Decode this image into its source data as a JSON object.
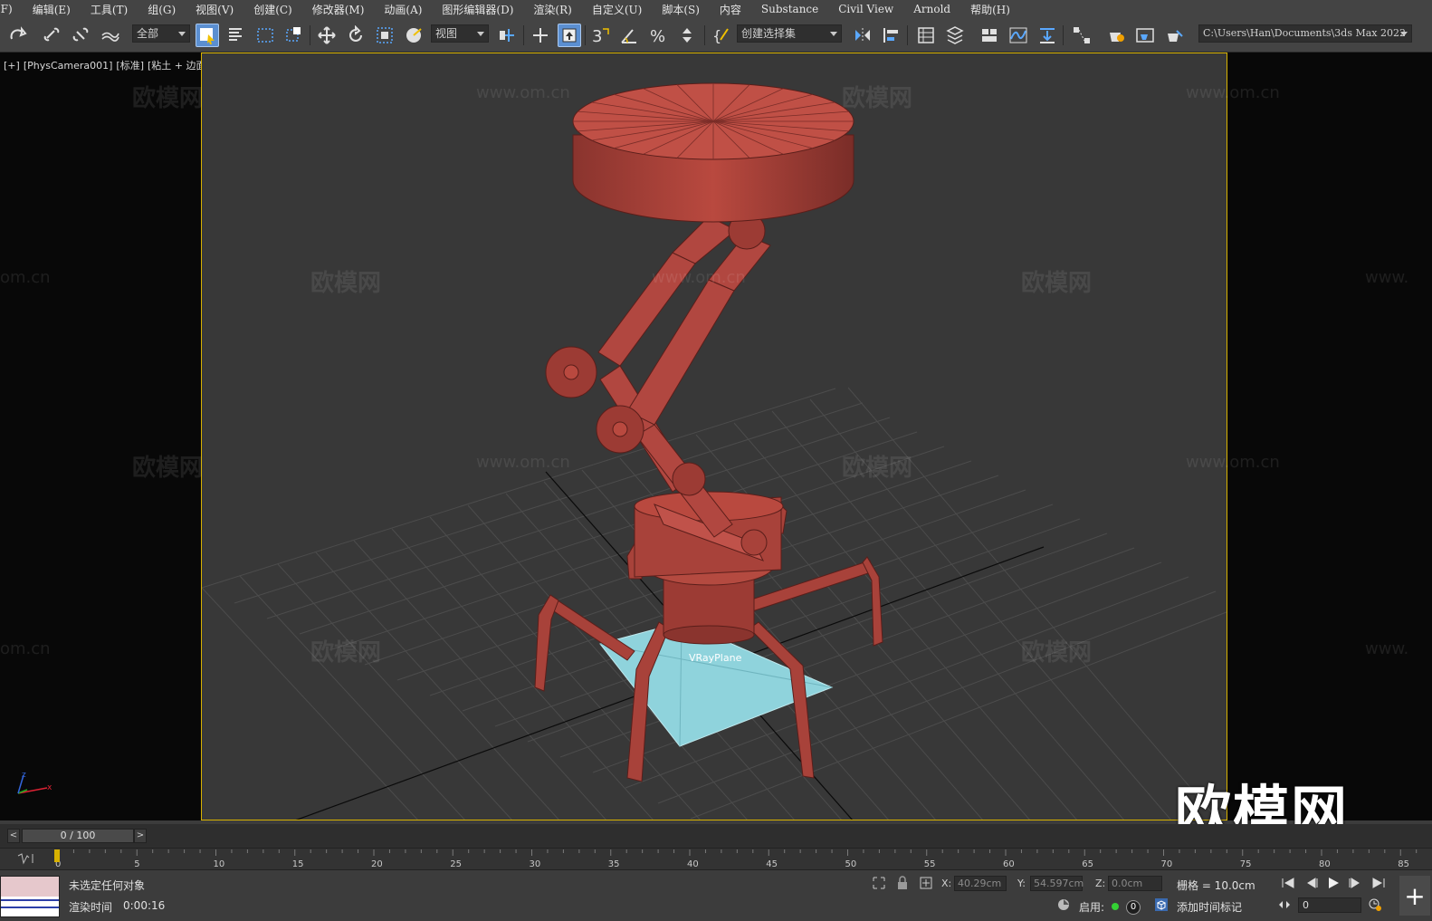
{
  "menu": [
    "(F)",
    "编辑(E)",
    "工具(T)",
    "组(G)",
    "视图(V)",
    "创建(C)",
    "修改器(M)",
    "动画(A)",
    "图形编辑器(D)",
    "渲染(R)",
    "自定义(U)",
    "脚本(S)",
    "内容",
    "Substance",
    "Civil View",
    "Arnold",
    "帮助(H)"
  ],
  "toolbar": {
    "filter_value": "全部",
    "reference_coord": "视图",
    "selection_set": "创建选择集",
    "snap_value": "3",
    "project_path": "C:\\Users\\Han\\Documents\\3ds Max 2022"
  },
  "viewport": {
    "label_plus": "[+]",
    "label_camera": "[PhysCamera001]",
    "label_shading": "[标准]",
    "label_mode": "[粘土 + 边面]",
    "object_label": "VRayPlane",
    "watermark_cn": "欧模网",
    "watermark_url": "www.om.cn",
    "watermark_url_cut": "om.cn",
    "watermark_url_cut_right": "www.",
    "brand": "欧模网"
  },
  "timeslider": {
    "frame_text": "0 / 100",
    "prev": "<",
    "next": ">"
  },
  "timeline": {
    "ticks": [
      "0",
      "5",
      "10",
      "15",
      "20",
      "25",
      "30",
      "35",
      "40",
      "45",
      "50",
      "55",
      "60",
      "65",
      "70",
      "75",
      "80",
      "85"
    ]
  },
  "status": {
    "selection": "未选定任何对象",
    "render_time_label": "渲染时间",
    "render_time": "0:00:16",
    "x_label": "X:",
    "x_value": "40.29cm",
    "y_label": "Y:",
    "y_value": "54.597cm",
    "z_label": "Z:",
    "z_value": "0.0cm",
    "grid": "栅格 = 10.0cm",
    "enable": "启用:",
    "key_count": "0",
    "add_time_tag": "添加时间标记",
    "frame_value": "0"
  },
  "colors": {
    "model": "#b3473f",
    "plane": "#8fd3dc",
    "viewport_border": "#d8b200"
  }
}
